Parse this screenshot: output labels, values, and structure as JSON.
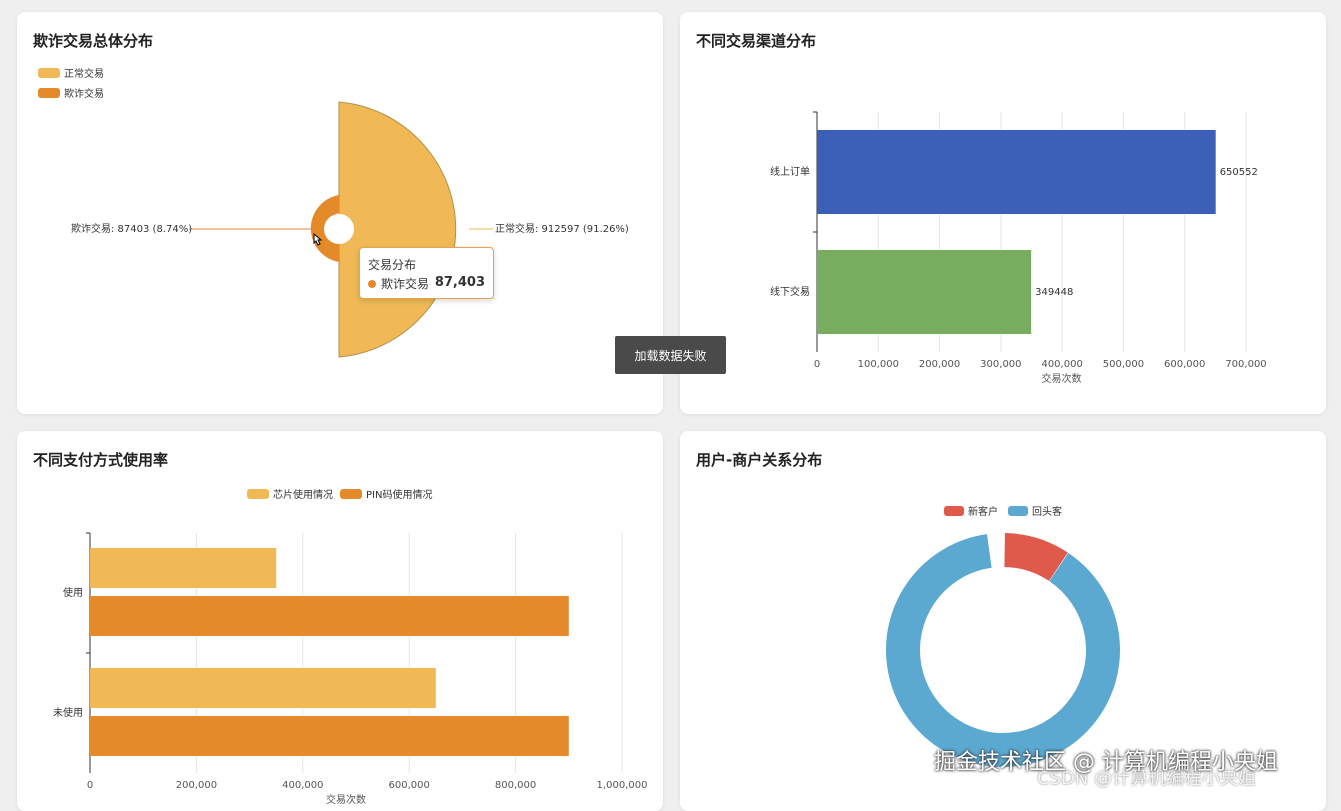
{
  "cards": [
    {
      "title": "欺诈交易总体分布"
    },
    {
      "title": "不同交易渠道分布"
    },
    {
      "title": "不同支付方式使用率"
    },
    {
      "title": "用户-商户关系分布"
    }
  ],
  "toast": "加载数据失败",
  "tooltip": {
    "title": "交易分布",
    "name": "欺诈交易",
    "value": "87,403"
  },
  "watermark": {
    "line1": "掘金技术社区 @ 计算机编程小央姐",
    "line2": "CSDN @计算机编程小央姐"
  },
  "colors": {
    "yellow": "#f0b955",
    "orange": "#e58a2b",
    "blue": "#3c5fb8",
    "green": "#76ad5f",
    "red": "#e05a4c",
    "lightblue": "#5ba8d0"
  },
  "chart_data": [
    {
      "type": "pie",
      "legend": [
        "正常交易",
        "欺诈交易"
      ],
      "slices": [
        {
          "name": "正常交易",
          "value": 912597,
          "percent": 91.26,
          "label": "正常交易: 912597 (91.26%)"
        },
        {
          "name": "欺诈交易",
          "value": 87403,
          "percent": 8.74,
          "label": "欺诈交易: 87403 (8.74%)"
        }
      ]
    },
    {
      "type": "bar",
      "orientation": "horizontal",
      "categories": [
        "线上订单",
        "线下交易"
      ],
      "values": [
        650552,
        349448
      ],
      "value_labels": [
        "650552",
        "349448"
      ],
      "xlabel": "交易次数",
      "xlim": [
        0,
        700000
      ],
      "xticks": [
        "0",
        "100,000",
        "200,000",
        "300,000",
        "400,000",
        "500,000",
        "600,000",
        "700,000"
      ]
    },
    {
      "type": "bar",
      "orientation": "horizontal",
      "legend": [
        "芯片使用情况",
        "PIN码使用情况"
      ],
      "categories": [
        "使用",
        "未使用"
      ],
      "series": [
        {
          "name": "芯片使用情况",
          "values": [
            350000,
            650000
          ]
        },
        {
          "name": "PIN码使用情况",
          "values": [
            900000,
            900000
          ]
        }
      ],
      "xlim": [
        0,
        1000000
      ],
      "xticks": [
        "0",
        "200,000",
        "400,000",
        "600,000",
        "800,000",
        "1,000,000"
      ],
      "xlabel": "交易次数"
    },
    {
      "type": "pie",
      "legend": [
        "新客户",
        "回头客"
      ],
      "slices": [
        {
          "name": "新客户",
          "percent": 10
        },
        {
          "name": "回头客",
          "percent": 90
        }
      ]
    }
  ]
}
